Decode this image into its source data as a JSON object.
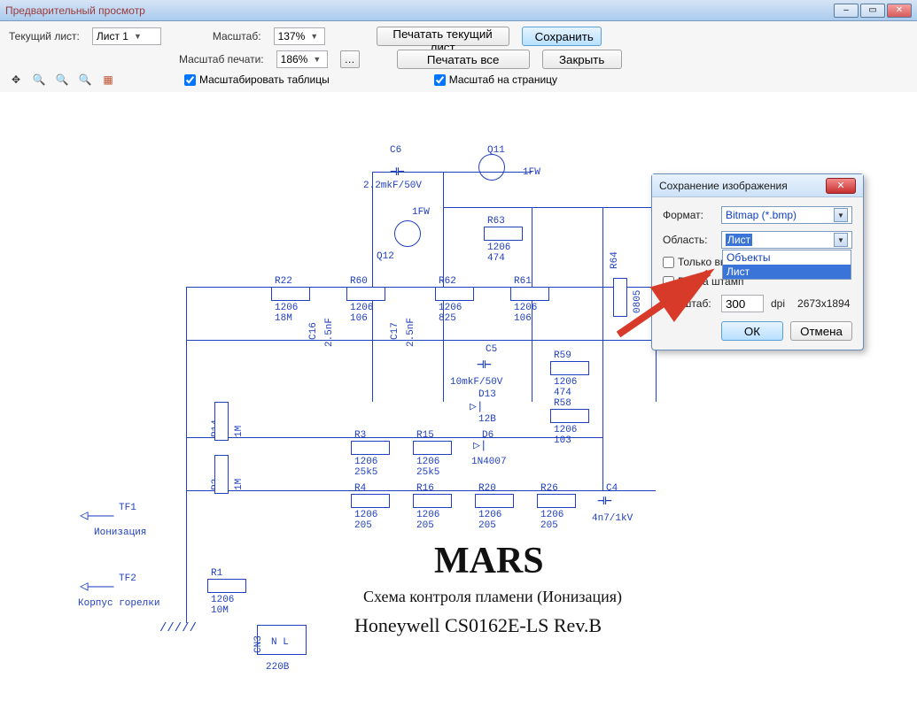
{
  "window": {
    "title": "Предварительный просмотр"
  },
  "toolbar": {
    "current_sheet_label": "Текущий лист:",
    "current_sheet_value": "Лист 1",
    "scale_label": "Масштаб:",
    "scale_value": "137%",
    "print_scale_label": "Масштаб печати:",
    "print_scale_value": "186%",
    "print_current_btn": "Печатать текущий лист",
    "save_btn": "Сохранить",
    "print_all_btn": "Печатать все",
    "close_btn": "Закрыть",
    "scale_tables_cb": "Масштабировать таблицы",
    "fit_page_cb": "Масштаб на страницу"
  },
  "dialog": {
    "title": "Сохранение изображения",
    "format_label": "Формат:",
    "format_value": "Bitmap (*.bmp)",
    "area_label": "Область:",
    "area_value": "Лист",
    "area_options": {
      "objects": "Объекты",
      "sheet": "Лист"
    },
    "only_selected_cb": "Только выд",
    "frame_stamp_cb": "Рамка     штамп",
    "scale_label": "Масштаб:",
    "dpi_value": "300",
    "dpi_suffix": "dpi",
    "dimensions": "2673x1894",
    "ok_btn": "ОК",
    "cancel_btn": "Отмена"
  },
  "schematic": {
    "c6": {
      "ref": "C6",
      "val": "2.2mkF/50V"
    },
    "q11": {
      "ref": "Q11",
      "val": "1FW"
    },
    "q12": {
      "ref": "Q12",
      "val": "1FW"
    },
    "r22": {
      "ref": "R22",
      "pkg": "1206",
      "val": "18M"
    },
    "r60": {
      "ref": "R60",
      "pkg": "1206",
      "val": "106"
    },
    "r62": {
      "ref": "R62",
      "pkg": "1206",
      "val": "825"
    },
    "r61": {
      "ref": "R61",
      "pkg": "1206",
      "val": "106"
    },
    "r63": {
      "ref": "R63",
      "pkg": "1206",
      "val": "474"
    },
    "r64": {
      "ref": "R64",
      "pkg": "0805"
    },
    "c16": {
      "ref": "C16",
      "val": "2.5nF"
    },
    "c17": {
      "ref": "C17",
      "val": "2.5nF"
    },
    "c5": {
      "ref": "C5",
      "val": "10mkF/50V"
    },
    "r59": {
      "ref": "R59",
      "pkg": "1206",
      "val": "474"
    },
    "d13": {
      "ref": "D13",
      "val": "12B"
    },
    "r58": {
      "ref": "R58",
      "pkg": "1206",
      "val": "103"
    },
    "r3": {
      "ref": "R3",
      "pkg": "1206",
      "val": "25k5"
    },
    "r15": {
      "ref": "R15",
      "pkg": "1206",
      "val": "25k5"
    },
    "d6": {
      "ref": "D6",
      "val": "1N4007"
    },
    "r4": {
      "ref": "R4",
      "pkg": "1206",
      "val": "205"
    },
    "r16": {
      "ref": "R16",
      "pkg": "1206",
      "val": "205"
    },
    "r20": {
      "ref": "R20",
      "pkg": "1206",
      "val": "205"
    },
    "r26": {
      "ref": "R26",
      "pkg": "1206",
      "val": "205"
    },
    "c4": {
      "ref": "C4",
      "val": "4n7/1kV"
    },
    "r14": {
      "ref": "R14",
      "val": "1M"
    },
    "r2": {
      "ref": "R2",
      "val": "1M"
    },
    "r1": {
      "ref": "R1",
      "pkg": "1206",
      "val": "10M"
    },
    "tf1": "TF1",
    "tf2": "TF2",
    "ionization": "Ионизация",
    "burner_body": "Корпус горелки",
    "cn3": "CN3",
    "cn3_label": "N  L",
    "voltage": "220В",
    "title_main": "MARS",
    "title_sub": "Схема контроля пламени (Ионизация)",
    "title_model": "Honeywell CS0162E-LS Rev.B"
  }
}
